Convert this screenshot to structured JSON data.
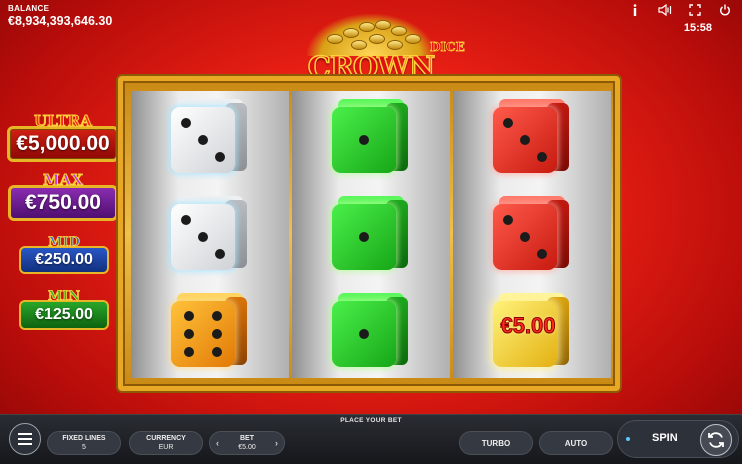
{
  "header": {
    "balance_label": "BALANCE",
    "balance_value": "€8,934,393,646.30",
    "clock": "15:58",
    "icons": [
      "info-icon",
      "sound-icon",
      "fullscreen-icon",
      "power-icon"
    ]
  },
  "logo": {
    "title": "CROWN COINS",
    "subtitle": "DICE"
  },
  "jackpots": {
    "ultra": {
      "name": "ULTRA",
      "value": "€5,000.00",
      "color": "#c81a10"
    },
    "max": {
      "name": "MAX",
      "value": "€750.00",
      "color": "#7a22a6"
    },
    "mid": {
      "name": "MID",
      "value": "€250.00",
      "color": "#2450c0"
    },
    "min": {
      "name": "MIN",
      "value": "€125.00",
      "color": "#239a24"
    }
  },
  "reels": [
    {
      "symbols": [
        {
          "color": "white",
          "pips": 3
        },
        {
          "color": "white",
          "pips": 3
        },
        {
          "color": "orange",
          "pips": 6
        }
      ]
    },
    {
      "symbols": [
        {
          "color": "green",
          "pips": 1
        },
        {
          "color": "green",
          "pips": 1
        },
        {
          "color": "green",
          "pips": 1
        }
      ]
    },
    {
      "symbols": [
        {
          "color": "red",
          "pips": 3
        },
        {
          "color": "red",
          "pips": 3
        },
        {
          "color": "gold",
          "value": "€5.00"
        }
      ]
    }
  ],
  "bottom_bar": {
    "prompt": "PLACE YOUR BET",
    "fixed_lines_label": "FIXED LINES",
    "fixed_lines_value": "5",
    "currency_label": "CURRENCY",
    "currency_value": "EUR",
    "bet_label": "BET",
    "bet_value": "€5.00",
    "turbo_label": "TURBO",
    "auto_label": "AUTO",
    "spin_label": "SPIN"
  }
}
